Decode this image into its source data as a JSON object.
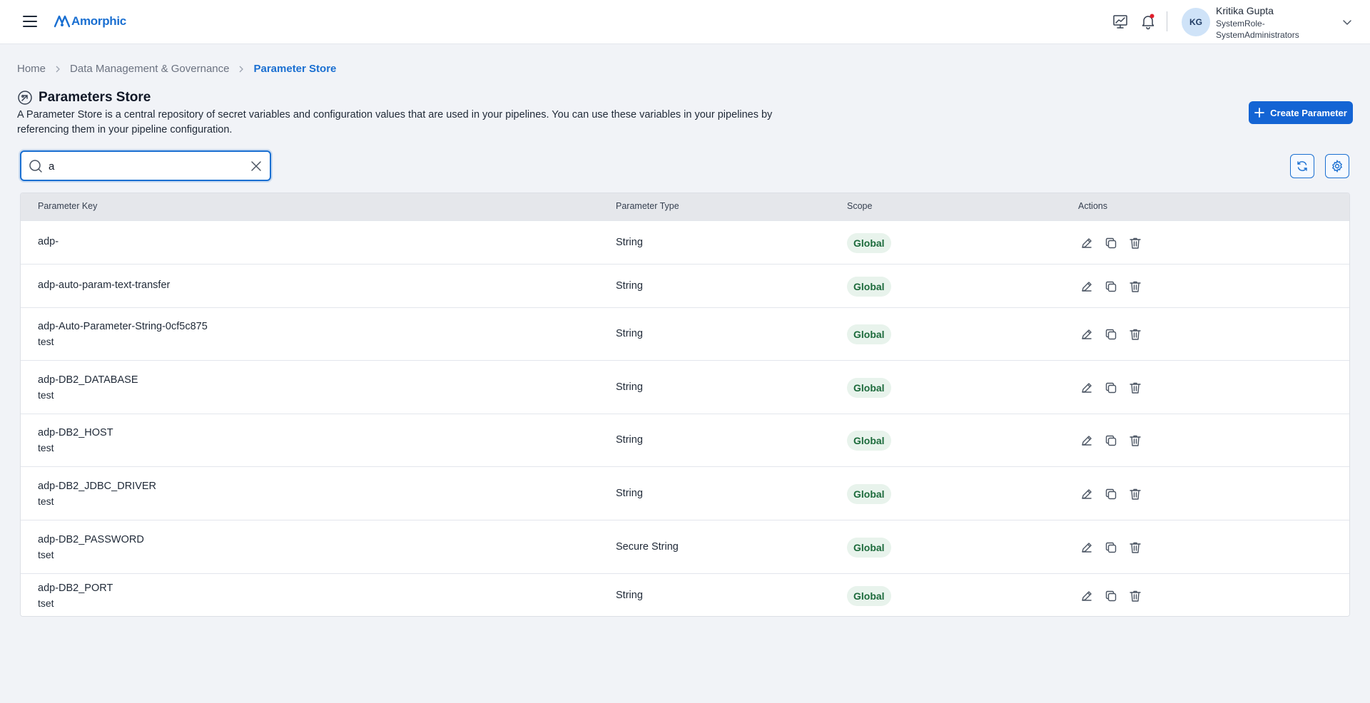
{
  "header": {
    "app_name": "Amorphic",
    "user": {
      "initials": "KG",
      "name": "Kritika Gupta",
      "role": "SystemRole-SystemAdministrators"
    }
  },
  "breadcrumb": {
    "items": [
      "Home",
      "Data Management & Governance"
    ],
    "current": "Parameter Store"
  },
  "page": {
    "title": "Parameters Store",
    "description": "A Parameter Store is a central repository of secret variables and configuration values that are used in your pipelines. You can use these variables in your pipelines by referencing them in your pipeline configuration.",
    "create_button": "Create Parameter"
  },
  "search": {
    "value": "a",
    "placeholder": ""
  },
  "table": {
    "columns": [
      "Parameter Key",
      "Parameter Type",
      "Scope",
      "Actions"
    ],
    "rows": [
      {
        "key": "adp-",
        "description": "",
        "type": "String",
        "scope": "Global"
      },
      {
        "key": "adp-auto-param-text-transfer",
        "description": "",
        "type": "String",
        "scope": "Global"
      },
      {
        "key": "adp-Auto-Parameter-String-0cf5c875",
        "description": "test",
        "type": "String",
        "scope": "Global"
      },
      {
        "key": "adp-DB2_DATABASE",
        "description": "test",
        "type": "String",
        "scope": "Global"
      },
      {
        "key": "adp-DB2_HOST",
        "description": "test",
        "type": "String",
        "scope": "Global"
      },
      {
        "key": "adp-DB2_JDBC_DRIVER",
        "description": "test",
        "type": "String",
        "scope": "Global"
      },
      {
        "key": "adp-DB2_PASSWORD",
        "description": "tset",
        "type": "Secure String",
        "scope": "Global"
      },
      {
        "key": "adp-DB2_PORT",
        "description": "tset",
        "type": "String",
        "scope": "Global"
      }
    ]
  },
  "colors": {
    "accent": "#1a6fd1",
    "primary_button": "#1464d4",
    "badge_bg": "#e8f3ec",
    "badge_text": "#1d6b3c",
    "notification_dot": "#e11d2a"
  },
  "icons": [
    "menu-icon",
    "amorphic-logo-icon",
    "monitor-chart-icon",
    "bell-icon",
    "chevron-down-icon",
    "chevron-right-icon",
    "parameters-icon",
    "plus-icon",
    "search-icon",
    "close-icon",
    "refresh-icon",
    "settings-icon",
    "edit-icon",
    "copy-icon",
    "delete-icon"
  ]
}
